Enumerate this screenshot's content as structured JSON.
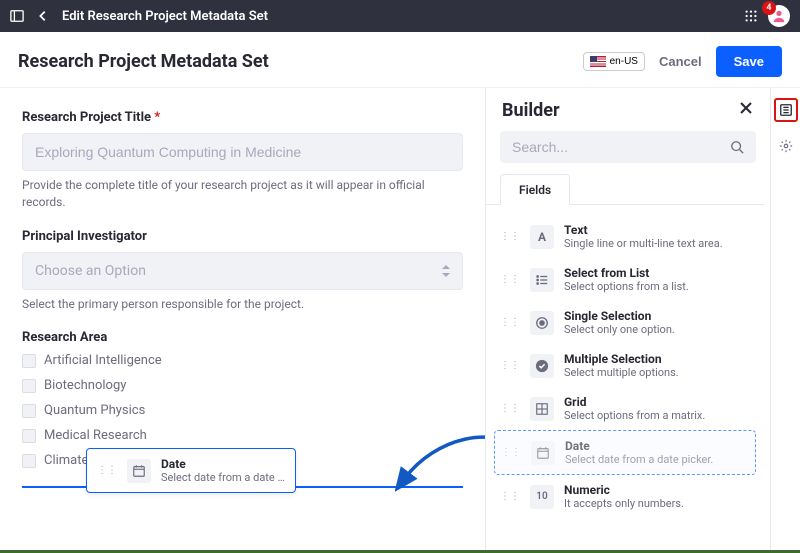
{
  "topbar": {
    "title": "Edit Research Project Metadata Set",
    "notif_count": "4"
  },
  "header": {
    "title": "Research Project Metadata Set",
    "locale": "en-US",
    "cancel": "Cancel",
    "save": "Save"
  },
  "form": {
    "title_label": "Research Project Title",
    "title_placeholder": "Exploring Quantum Computing in Medicine",
    "title_help": "Provide the complete title of your research project as it will appear in official records.",
    "pi_label": "Principal Investigator",
    "pi_placeholder": "Choose an Option",
    "pi_help": "Select the primary person responsible for the project.",
    "area_label": "Research Area",
    "area_options": [
      "Artificial Intelligence",
      "Biotechnology",
      "Quantum Physics",
      "Medical Research",
      "Climate Science"
    ]
  },
  "drop_card": {
    "title": "Date",
    "desc": "Select date from a date pic…"
  },
  "builder": {
    "title": "Builder",
    "search_placeholder": "Search...",
    "tab": "Fields",
    "fields": [
      {
        "icon": "A",
        "title": "Text",
        "desc": "Single line or multi-line text area."
      },
      {
        "icon": "list",
        "title": "Select from List",
        "desc": "Select options from a list."
      },
      {
        "icon": "radio",
        "title": "Single Selection",
        "desc": "Select only one option."
      },
      {
        "icon": "check",
        "title": "Multiple Selection",
        "desc": "Select multiple options."
      },
      {
        "icon": "grid",
        "title": "Grid",
        "desc": "Select options from a matrix."
      },
      {
        "icon": "date",
        "title": "Date",
        "desc": "Select date from a date picker."
      },
      {
        "icon": "10",
        "title": "Numeric",
        "desc": "It accepts only numbers."
      }
    ]
  }
}
